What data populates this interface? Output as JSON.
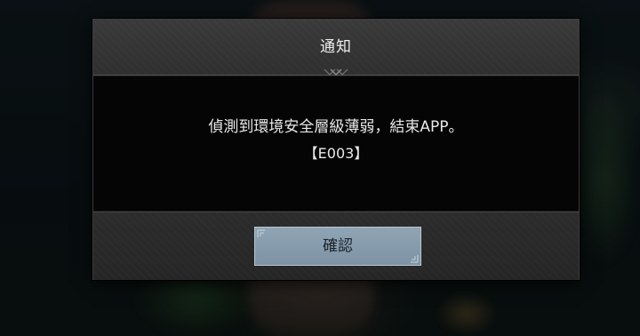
{
  "dialog": {
    "title": "通知",
    "message": "偵測到環境安全層級薄弱，結束APP。",
    "error_code": "【E003】",
    "confirm_label": "確認"
  },
  "colors": {
    "header_bg": "#343434",
    "body_bg": "#050505",
    "footer_bg": "#292929",
    "button_bg": "#8a9fae",
    "button_text": "#1c232a",
    "text": "#e8e8e8"
  },
  "icons": {
    "header_ornament": "chevron-ornament-icon",
    "button_corner": "corner-flourish-icon"
  }
}
